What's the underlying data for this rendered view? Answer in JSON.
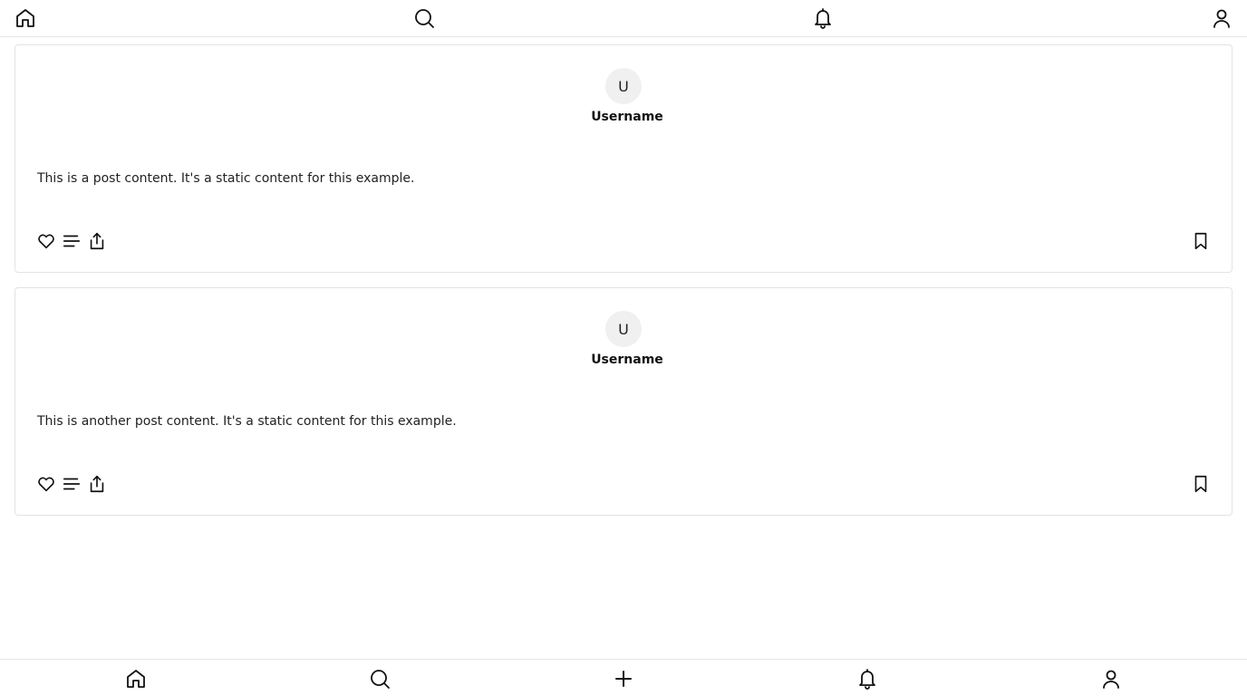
{
  "top_nav": {
    "icons": [
      "home-icon",
      "search-icon",
      "bell-icon",
      "user-icon"
    ]
  },
  "posts": [
    {
      "avatar_initial": "U",
      "username": "Username",
      "content": "This is a post content. It's a static content for this example.",
      "actions": [
        "heart-icon",
        "comment-icon",
        "share-icon",
        "bookmark-icon"
      ]
    },
    {
      "avatar_initial": "U",
      "username": "Username",
      "content": "This is another post content. It's a static content for this example.",
      "actions": [
        "heart-icon",
        "comment-icon",
        "share-icon",
        "bookmark-icon"
      ]
    }
  ],
  "bottom_nav": {
    "icons": [
      "home-icon",
      "search-icon",
      "plus-icon",
      "bell-icon",
      "user-icon"
    ]
  },
  "colors": {
    "background": "#ffffff",
    "border": "#e3e3e3",
    "avatar_bg": "#f0f0f0",
    "text": "#111111"
  }
}
